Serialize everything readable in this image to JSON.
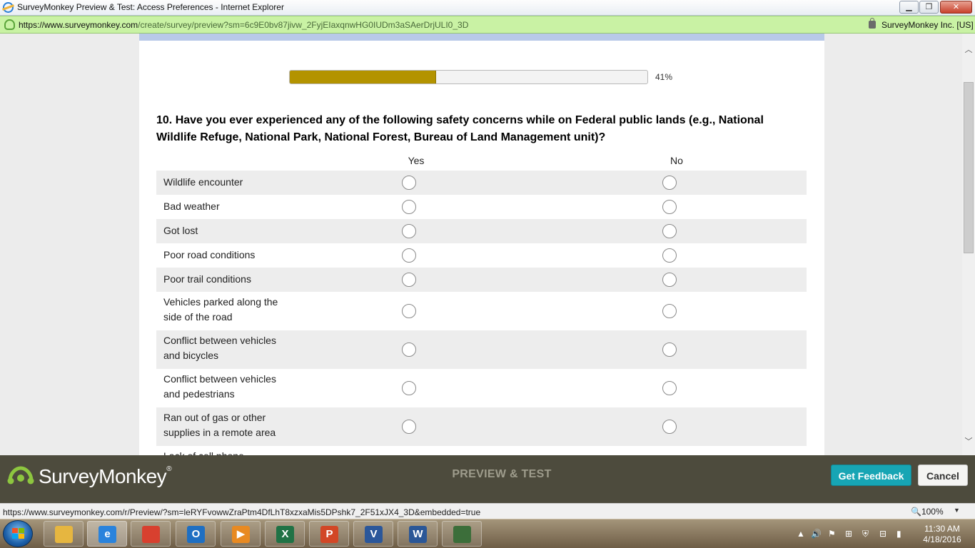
{
  "window": {
    "title": "SurveyMonkey Preview & Test: Access Preferences - Internet Explorer",
    "minimize_glyph": "▁",
    "maximize_glyph": "❐",
    "close_glyph": "✕"
  },
  "address_bar": {
    "url_host": "https://www.surveymonkey.com",
    "url_path": "/create/survey/preview?sm=6c9E0bv87jivw_2FyjEIaxqnwHG0IUDm3aSAerDrjULI0_3D",
    "certificate": "SurveyMonkey Inc. [US]"
  },
  "progress": {
    "percent": 41,
    "label": "41%"
  },
  "question": {
    "title": "10. Have you ever experienced any of the following safety concerns while on Federal public lands (e.g., National Wildlife Refuge, National Park, National Forest, Bureau of Land Management unit)?",
    "columns": [
      "Yes",
      "No"
    ],
    "rows": [
      {
        "label": "Wildlife encounter"
      },
      {
        "label": "Bad weather"
      },
      {
        "label": "Got lost"
      },
      {
        "label": "Poor road conditions"
      },
      {
        "label": "Poor trail conditions"
      },
      {
        "label": "Vehicles parked along the side of the road"
      },
      {
        "label": "Conflict between vehicles and bicycles"
      },
      {
        "label": "Conflict between vehicles and pedestrians"
      },
      {
        "label": "Ran out of gas or other supplies in a remote area"
      },
      {
        "label": "Lack of cell phone"
      }
    ]
  },
  "footer": {
    "brand": "SurveyMonkey",
    "registered": "®",
    "mode": "PREVIEW & TEST",
    "feedback_button": "Get Feedback",
    "cancel_button": "Cancel",
    "brand_color": "#8dc63f",
    "feedback_color": "#17a5b4"
  },
  "status_bar": {
    "link": "https://www.surveymonkey.com/r/Preview/?sm=leRYFvowwZraPtm4DfLhT8xzxaMis5DPshk7_2F51xJX4_3D&embedded=true",
    "zoom": "100%",
    "zoom_caret": "▼"
  },
  "taskbar": {
    "apps": [
      {
        "name": "file-explorer-icon",
        "glyph": "",
        "color": "#e6b640"
      },
      {
        "name": "internet-explorer-icon",
        "glyph": "e",
        "color": "#2a83dc"
      },
      {
        "name": "chrome-icon",
        "glyph": "",
        "color": "#d8402f"
      },
      {
        "name": "outlook-icon",
        "glyph": "O",
        "color": "#1f6fc2"
      },
      {
        "name": "media-player-icon",
        "glyph": "▶",
        "color": "#e88a22"
      },
      {
        "name": "excel-icon",
        "glyph": "X",
        "color": "#207245"
      },
      {
        "name": "powerpoint-icon",
        "glyph": "P",
        "color": "#d24726"
      },
      {
        "name": "visio-icon",
        "glyph": "V",
        "color": "#2b579a"
      },
      {
        "name": "word-icon",
        "glyph": "W",
        "color": "#2b5797"
      },
      {
        "name": "remote-desktop-icon",
        "glyph": "",
        "color": "#3c6e3a"
      }
    ],
    "time": "11:30 AM",
    "date": "4/18/2016"
  },
  "scroll": {
    "up_glyph": "︿",
    "down_glyph": "﹀"
  }
}
